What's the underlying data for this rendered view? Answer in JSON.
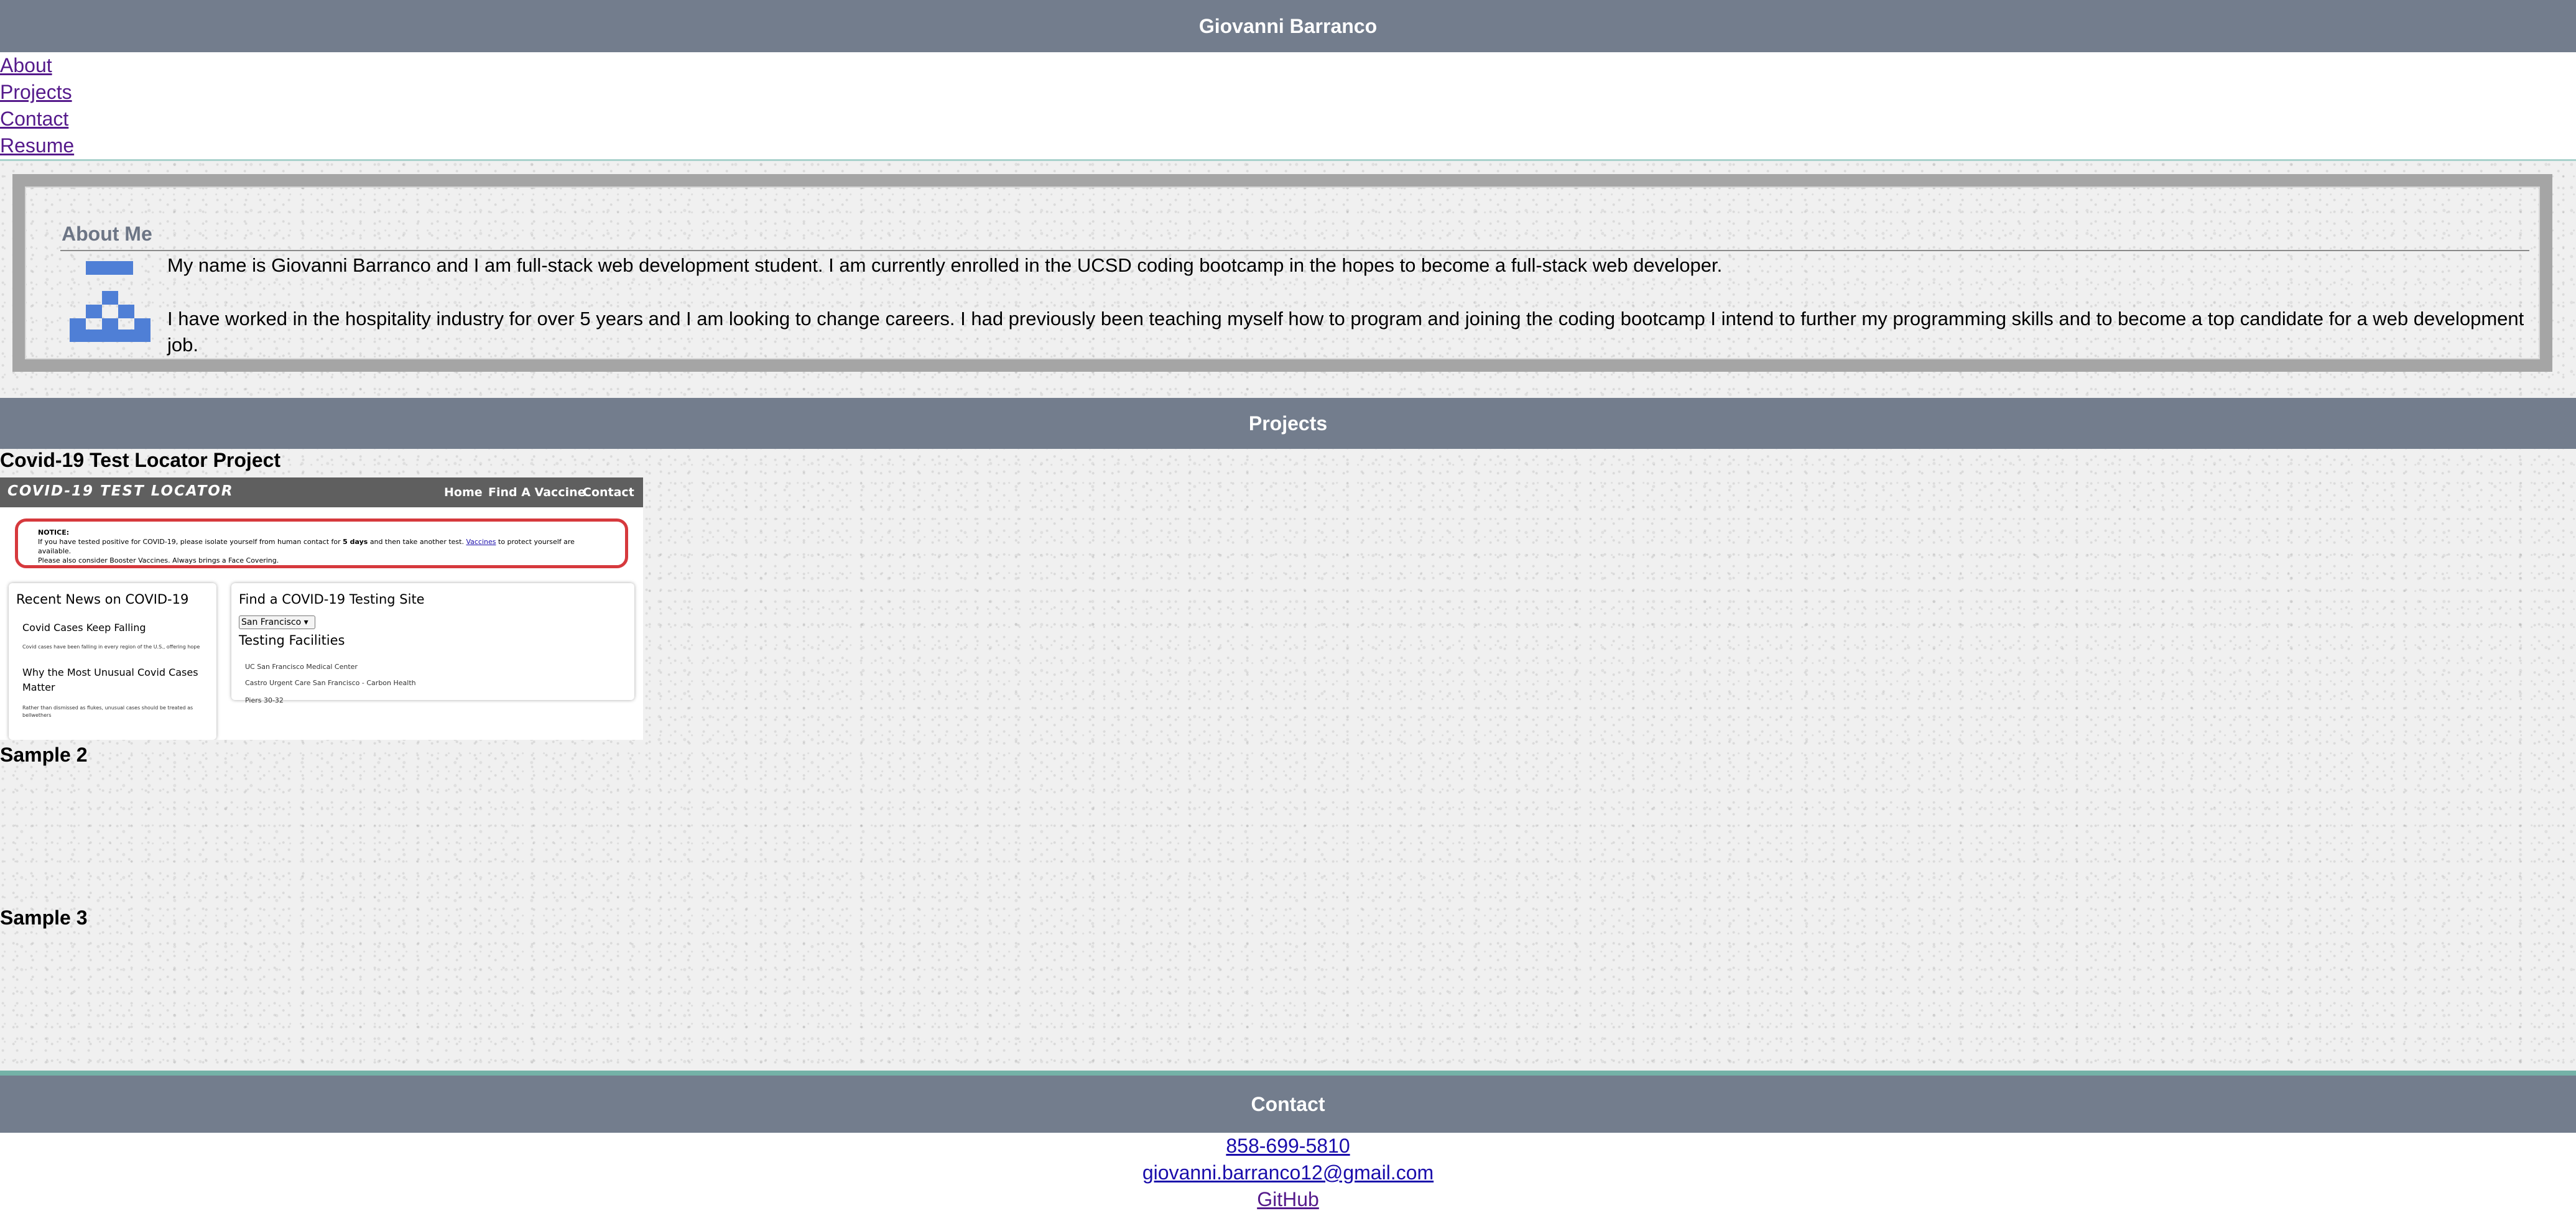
{
  "header": {
    "title": "Giovanni Barranco"
  },
  "nav": {
    "items": [
      "About",
      "Projects",
      "Contact",
      "Resume"
    ]
  },
  "about": {
    "title": "About Me",
    "p1": "My name is Giovanni Barranco and I am full-stack web development student. I am currently enrolled in the UCSD coding bootcamp in the hopes to become a full-stack web developer.",
    "p2": "I have worked in the hospitality industry for over 5 years and I am looking to change careers. I had previously been teaching myself how to program and joining the coding bootcamp I intend to further my programming skills and to become a top candidate for a web development job."
  },
  "projects": {
    "title": "Projects",
    "items": [
      {
        "title": "Covid-19 Test Locator Project"
      },
      {
        "title": "Sample 2"
      },
      {
        "title": "Sample 3"
      }
    ]
  },
  "screenshot": {
    "brand": "COVID-19 TEST LOCATOR",
    "nav": [
      "Home",
      "Find A Vaccine",
      "Contact"
    ],
    "notice_label": "NOTICE:",
    "notice_a": "If you have tested positive for COVID-19, please isolate yourself from human contact for",
    "notice_bold": "5 days",
    "notice_b": "and then take another test.",
    "notice_link": "Vaccines",
    "notice_c": "to protect yourself are available.",
    "notice_d": "Please also consider Booster Vaccines. Always brings a Face Covering.",
    "news_title": "Recent News on COVID-19",
    "news1_title": "Covid Cases Keep Falling",
    "news1_text": "Covid cases have been falling in every region of the U.S., offering hope",
    "news2_title_a": "Why the Most Unusual Covid Cases",
    "news2_title_b": "Matter",
    "news2_text_a": "Rather than dismissed as flukes, unusual cases should be treated as",
    "news2_text_b": "bellwethers",
    "find_title": "Find a COVID-19 Testing Site",
    "select_value": "San Francisco",
    "facilities_title": "Testing Facilities",
    "facilities": [
      "UC San Francisco Medical Center",
      "Castro Urgent Care San Francisco - Carbon Health",
      "Piers 30-32"
    ]
  },
  "contact": {
    "title": "Contact",
    "phone": "858-699-5810",
    "email": "giovanni.barranco12@gmail.com",
    "github": "GitHub"
  },
  "colors": {
    "header": "#737d8d",
    "accent_line": "#74b2a7",
    "about_border": "#a5a5a5",
    "avatar": "#4f7fd6"
  }
}
